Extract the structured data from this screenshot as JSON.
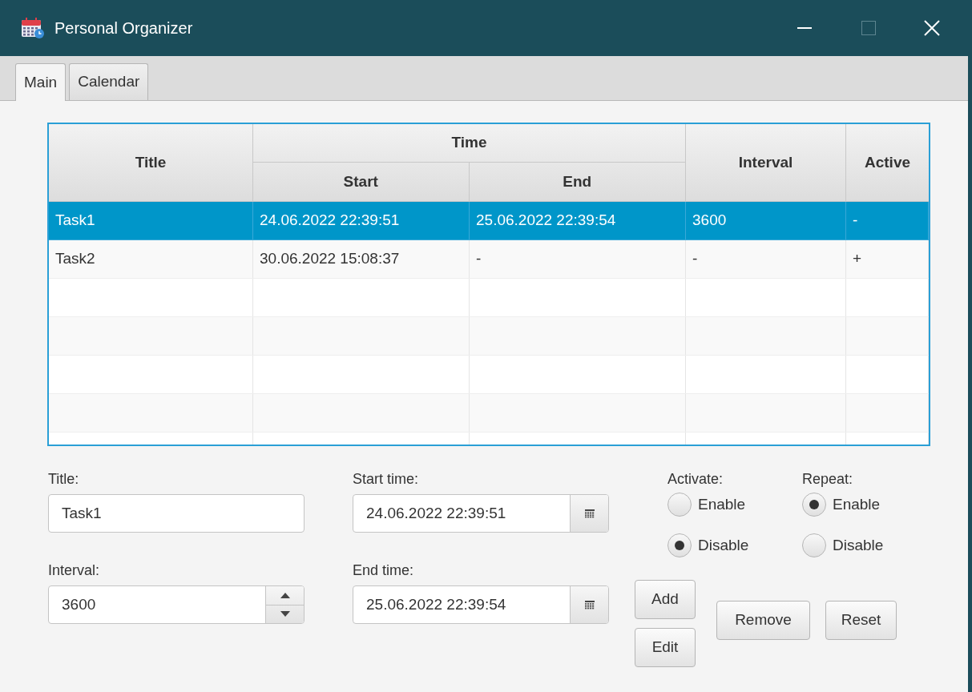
{
  "window": {
    "title": "Personal Organizer"
  },
  "tabs": [
    {
      "label": "Main",
      "selected": true
    },
    {
      "label": "Calendar",
      "selected": false
    }
  ],
  "table": {
    "columns": {
      "title": "Title",
      "time": "Time",
      "start": "Start",
      "end": "End",
      "interval": "Interval",
      "active": "Active"
    },
    "rows": [
      {
        "title": "Task1",
        "start": "24.06.2022 22:39:51",
        "end": "25.06.2022 22:39:54",
        "interval": "3600",
        "active": "-",
        "selected": true
      },
      {
        "title": "Task2",
        "start": "30.06.2022 15:08:37",
        "end": "-",
        "interval": "-",
        "active": "+",
        "selected": false
      }
    ]
  },
  "form": {
    "title": {
      "label": "Title:",
      "value": "Task1"
    },
    "interval": {
      "label": "Interval:",
      "value": "3600"
    },
    "start_time": {
      "label": "Start time:",
      "value": "24.06.2022 22:39:51"
    },
    "end_time": {
      "label": "End time:",
      "value": "25.06.2022 22:39:54"
    },
    "activate": {
      "label": "Activate:",
      "options": [
        {
          "label": "Enable",
          "selected": false
        },
        {
          "label": "Disable",
          "selected": true
        }
      ]
    },
    "repeat": {
      "label": "Repeat:",
      "options": [
        {
          "label": "Enable",
          "selected": true
        },
        {
          "label": "Disable",
          "selected": false
        }
      ]
    }
  },
  "buttons": {
    "add": "Add",
    "edit": "Edit",
    "remove": "Remove",
    "reset": "Reset"
  }
}
